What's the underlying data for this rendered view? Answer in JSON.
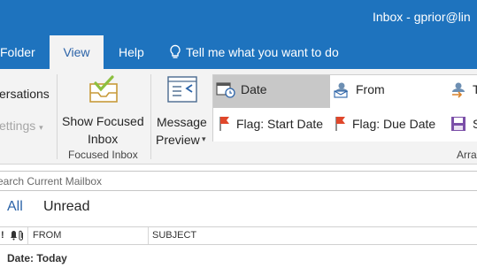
{
  "window": {
    "title": "Inbox - gprior@lin"
  },
  "tabs": {
    "folder": "Folder",
    "view": "View",
    "help": "Help",
    "tell_me": "Tell me what you want to do"
  },
  "ribbon": {
    "conversations_label": "ersations",
    "settings_label": "ettings",
    "focused_inbox": {
      "line1": "Show Focused",
      "line2": "Inbox",
      "group": "Focused Inbox"
    },
    "message_preview": {
      "line1": "Message",
      "line2": "Preview"
    },
    "arrangement": {
      "items": {
        "date": "Date",
        "from": "From",
        "to": "To",
        "flag_start": "Flag: Start Date",
        "flag_due": "Flag: Due Date",
        "size": "Si"
      },
      "group": "Arra"
    }
  },
  "search": {
    "placeholder": "earch Current Mailbox"
  },
  "filters": {
    "all": "All",
    "unread": "Unread"
  },
  "columns": {
    "importance": "!",
    "from": "FROM",
    "subject": "SUBJECT"
  },
  "group_header": "Date: Today",
  "colors": {
    "accent": "#1e73be",
    "ribbon_bg": "#f3f3f3",
    "selected": "#c8c8c8"
  }
}
